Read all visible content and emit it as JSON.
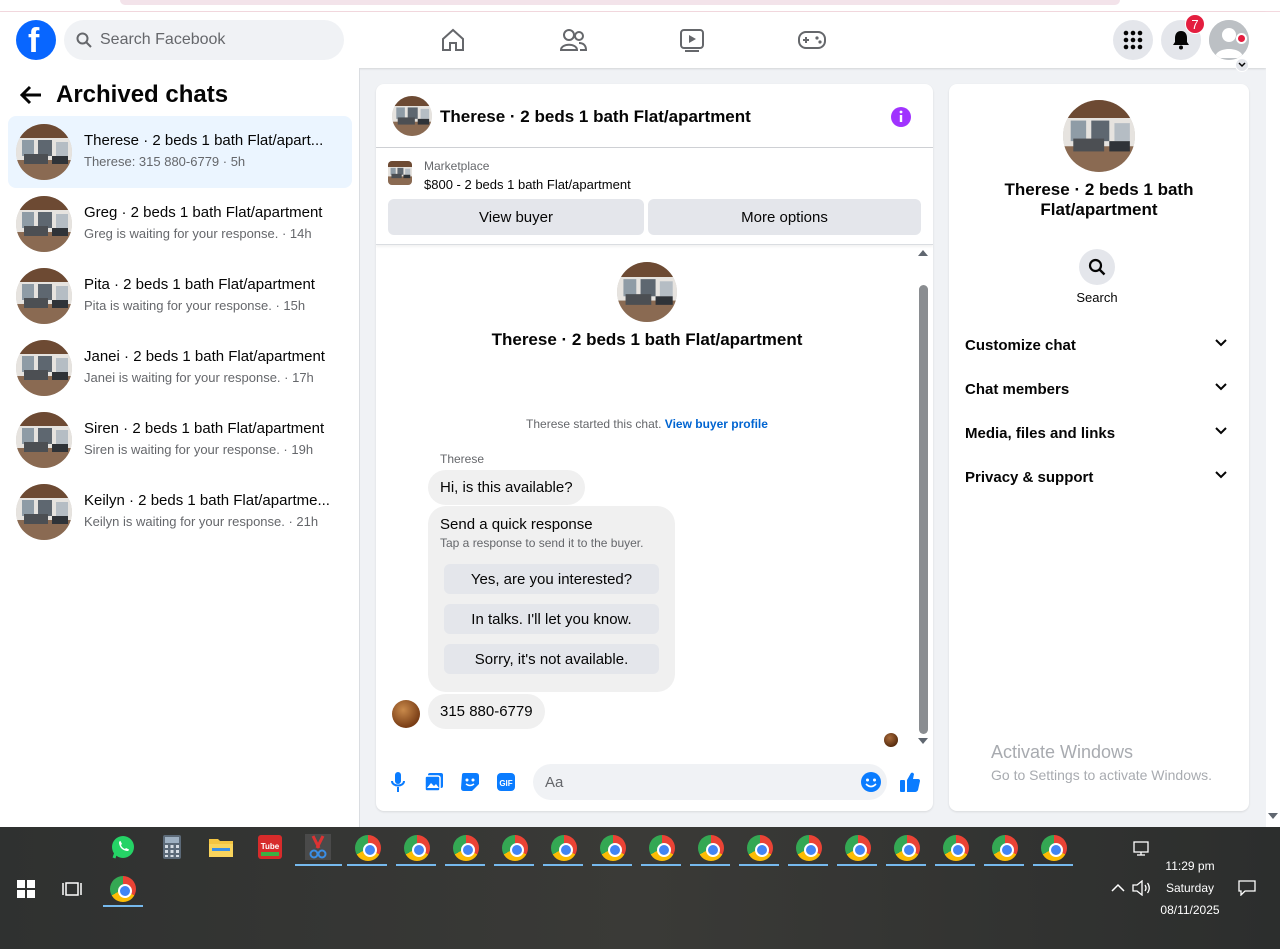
{
  "header": {
    "search_placeholder": "Search Facebook",
    "notification_count": "7",
    "nav": [
      "home-icon",
      "friends-icon",
      "video-icon",
      "gaming-icon"
    ]
  },
  "left": {
    "title": "Archived chats",
    "chats": [
      {
        "name": "Therese · 2 beds 1 bath Flat/apart...",
        "sub": "Therese: 315 880-6779 · 5h"
      },
      {
        "name": "Greg · 2 beds 1 bath Flat/apartment",
        "sub": "Greg is waiting for your response. · 14h"
      },
      {
        "name": "Pita · 2 beds 1 bath Flat/apartment",
        "sub": "Pita is waiting for your response. · 15h"
      },
      {
        "name": "Janei · 2 beds 1 bath Flat/apartment",
        "sub": "Janei is waiting for your response. · 17h"
      },
      {
        "name": "Siren · 2 beds 1 bath Flat/apartment",
        "sub": "Siren is waiting for your response. · 19h"
      },
      {
        "name": "Keilyn · 2 beds 1 bath Flat/apartme...",
        "sub": "Keilyn is waiting for your response. · 21h"
      }
    ]
  },
  "chat": {
    "title": "Therese · 2 beds 1 bath Flat/apartment",
    "marketplace_label": "Marketplace",
    "listing": "$800 - 2 beds 1 bath Flat/apartment",
    "view_buyer": "View buyer",
    "more_options": "More options",
    "conv_title": "Therese · 2 beds 1 bath Flat/apartment",
    "started_text": "Therese started this chat.",
    "buyer_profile_link": "View buyer profile",
    "sender": "Therese",
    "msg1": "Hi, is this available?",
    "quick_title": "Send a quick response",
    "quick_sub": "Tap a response to send it to the buyer.",
    "quick_options": [
      "Yes, are you interested?",
      "In talks. I'll let you know.",
      "Sorry, it's not available."
    ],
    "msg2": "315 880-6779",
    "composer_placeholder": "Aa"
  },
  "right": {
    "title": "Therese · 2 beds 1 bath Flat/apartment",
    "search_label": "Search",
    "sections": [
      "Customize chat",
      "Chat members",
      "Media, files and links",
      "Privacy & support"
    ]
  },
  "watermark": {
    "line1": "Activate Windows",
    "line2": "Go to Settings to activate Windows."
  },
  "taskbar": {
    "time": "11:29 pm",
    "day": "Saturday",
    "date": "08/11/2025"
  },
  "colors": {
    "accent": "#0866ff",
    "active_chat_bg": "#ebf5ff",
    "composer_icons": "#0a7cff",
    "info_icon": "#a033ff"
  }
}
